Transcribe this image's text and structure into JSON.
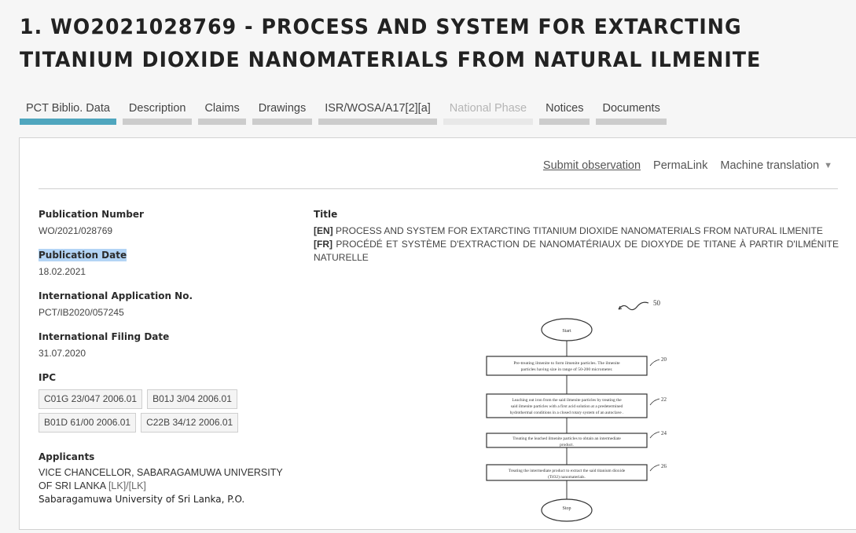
{
  "header": {
    "title": "1. WO2021028769 - PROCESS AND SYSTEM FOR EXTARCTING TITANIUM DIOXIDE NANOMATERIALS FROM NATURAL ILMENITE"
  },
  "tabs": [
    {
      "label": "PCT Biblio. Data",
      "state": "active"
    },
    {
      "label": "Description",
      "state": "normal"
    },
    {
      "label": "Claims",
      "state": "normal"
    },
    {
      "label": "Drawings",
      "state": "normal"
    },
    {
      "label": "ISR/WOSA/A17[2][a]",
      "state": "normal"
    },
    {
      "label": "National Phase",
      "state": "disabled"
    },
    {
      "label": "Notices",
      "state": "normal"
    },
    {
      "label": "Documents",
      "state": "normal"
    }
  ],
  "actions": {
    "submit_observation": "Submit observation",
    "permalink": "PermaLink",
    "machine_translation": "Machine translation",
    "caret": "▼"
  },
  "biblio": {
    "publication_number": {
      "label": "Publication Number",
      "value": "WO/2021/028769"
    },
    "publication_date": {
      "label": "Publication Date",
      "value": "18.02.2021"
    },
    "international_application_no": {
      "label": "International Application No.",
      "value": "PCT/IB2020/057245"
    },
    "international_filing_date": {
      "label": "International Filing Date",
      "value": "31.07.2020"
    },
    "ipc": {
      "label": "IPC",
      "codes": [
        "C01G 23/047 2006.01",
        "B01J 3/04 2006.01",
        "B01D 61/00 2006.01",
        "C22B 34/12 2006.01"
      ]
    },
    "applicants": {
      "label": "Applicants",
      "name": "VICE CHANCELLOR, SABARAGAMUWA UNIVERSITY OF SRI LANKA",
      "country": "[LK]/[LK]",
      "address": "Sabaragamuwa University of Sri Lanka, P.O."
    }
  },
  "title_section": {
    "label": "Title",
    "en_tag": "[EN]",
    "en": "PROCESS AND SYSTEM FOR EXTARCTING TITANIUM DIOXIDE NANOMATERIALS FROM NATURAL ILMENITE",
    "fr_tag": "[FR]",
    "fr": "PROCÉDÉ ET SYSTÈME D'EXTRACTION DE NANOMATÉRIAUX DE DIOXYDE DE TITANE À PARTIR D'ILMÉNITE NATURELLE"
  },
  "drawing": {
    "figure_ref": "50",
    "start": "Start",
    "stop": "Stop",
    "steps": [
      {
        "ref": "20",
        "lines": [
          "Pre-treating ilmenite to form ilmenite particles. The ilmenite",
          "particles having size in range of 50-200 micrometer."
        ]
      },
      {
        "ref": "22",
        "lines": [
          "Leaching out iron from the said ilmenite particles by treating the",
          "said ilmenite particles with a first acid solution at a predetermined",
          "hydrothermal conditions in a closed rotary system of an autoclave ."
        ]
      },
      {
        "ref": "24",
        "lines": [
          "Treating the leached ilmenite particles to obtain an intermediate",
          "product."
        ]
      },
      {
        "ref": "26",
        "lines": [
          "Treating the intermediate product to extract the said titanium dioxide",
          "(TiO2) nanomaterials."
        ]
      }
    ]
  }
}
